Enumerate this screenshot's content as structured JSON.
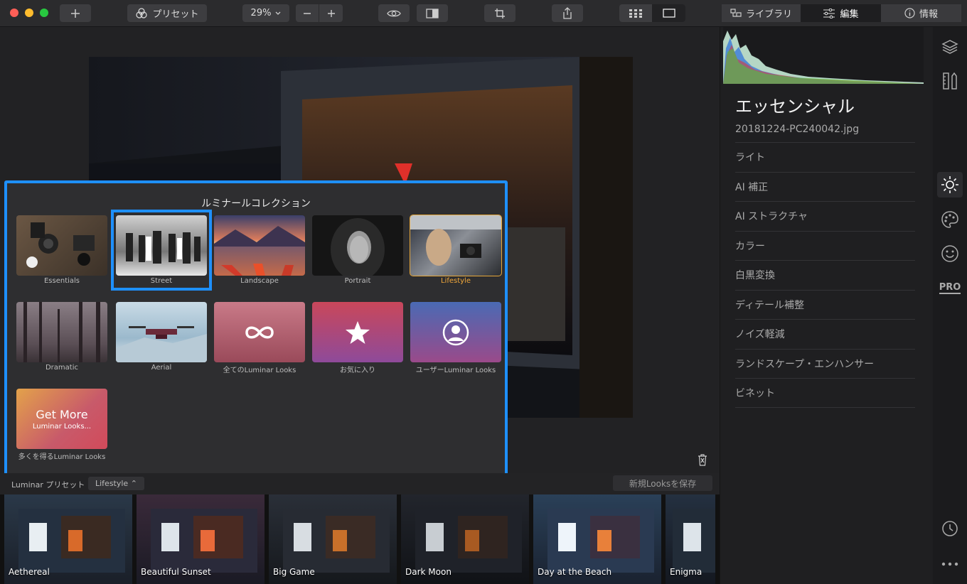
{
  "toolbar": {
    "preset_label": "プリセット",
    "zoom_value": "29%",
    "tabs": [
      {
        "label": "ライブラリ",
        "icon": "library-icon"
      },
      {
        "label": "編集",
        "icon": "sliders-icon"
      },
      {
        "label": "情報",
        "icon": "info-icon"
      }
    ],
    "colors": {
      "close": "#fe5f57",
      "minimize": "#febc2e",
      "maximize": "#28c840"
    }
  },
  "popup": {
    "title": "ルミナールコレクション",
    "tiles": [
      {
        "label": "Essentials"
      },
      {
        "label": "Street"
      },
      {
        "label": "Landscape"
      },
      {
        "label": "Portrait"
      },
      {
        "label": "Lifestyle"
      },
      {
        "label": "Dramatic"
      },
      {
        "label": "Aerial"
      },
      {
        "label": "全てのLuminar Looks"
      },
      {
        "label": "お気に入り"
      },
      {
        "label": "ユーザーLuminar Looks"
      },
      {
        "label": "多くを得るLuminar Looks",
        "big": "Get More",
        "small": "Luminar Looks..."
      }
    ],
    "selected": "Lifestyle",
    "highlight_color": "#1e90ff"
  },
  "presetbar": {
    "label": "Luminar プリセット",
    "category": "Lifestyle ⌃",
    "save_label": "新規Looksを保存"
  },
  "filmstrip": [
    {
      "name": "Aethereal"
    },
    {
      "name": "Beautiful Sunset"
    },
    {
      "name": "Big Game"
    },
    {
      "name": "Dark Moon"
    },
    {
      "name": "Day at the Beach"
    },
    {
      "name": "Enigma"
    }
  ],
  "panel": {
    "title": "エッセンシャル",
    "filename": "20181224-PC240042.jpg",
    "sections": [
      "ライト",
      "AI 補正",
      "AI ストラクチャ",
      "カラー",
      "白黒変換",
      "ディテール補整",
      "ノイズ軽減",
      "ランドスケープ・エンハンサー",
      "ビネット"
    ]
  },
  "sidebar": {
    "pro_label": "PRO"
  }
}
